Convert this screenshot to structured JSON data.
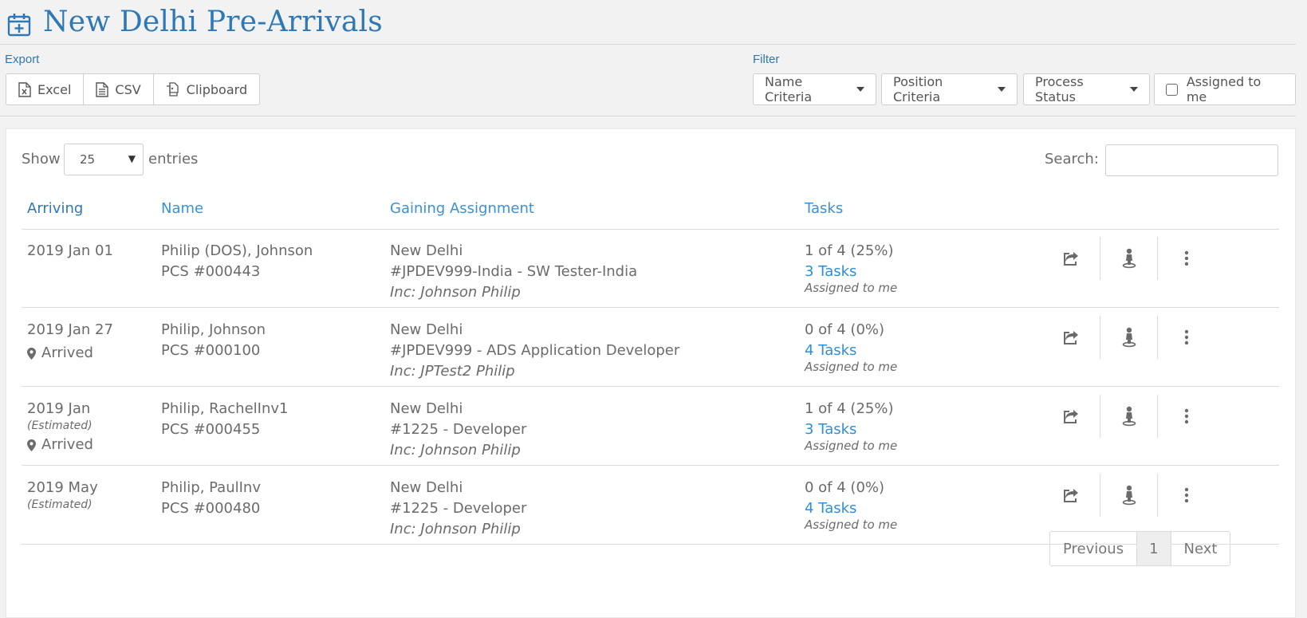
{
  "header": {
    "title": "New Delhi Pre-Arrivals",
    "icon": "calendar-plus-icon"
  },
  "export": {
    "label": "Export",
    "buttons": [
      {
        "label": "Excel",
        "icon": "excel-file-icon"
      },
      {
        "label": "CSV",
        "icon": "csv-file-icon"
      },
      {
        "label": "Clipboard",
        "icon": "clipboard-icon"
      }
    ]
  },
  "filter": {
    "label": "Filter",
    "dropdowns": [
      "Name Criteria",
      "Position Criteria",
      "Process Status"
    ],
    "assigned_label": "Assigned to me"
  },
  "table": {
    "show_label": "Show",
    "length_value": "25",
    "entries_label": "entries",
    "search_label": "Search:",
    "columns": [
      "Arriving",
      "Name",
      "Gaining Assignment",
      "Tasks"
    ],
    "rows": [
      {
        "arriving": "2019 Jan 01",
        "estimated": "",
        "arrived": "",
        "name": "Philip (DOS), Johnson",
        "pcs": "PCS #000443",
        "location": "New Delhi",
        "position": "#JPDEV999-India - SW Tester-India",
        "inc": "Inc: Johnson Philip",
        "progress": "1 of 4 (25%)",
        "tasks_link": "3 Tasks",
        "assigned": "Assigned to me"
      },
      {
        "arriving": "2019 Jan 27",
        "estimated": "",
        "arrived": "Arrived",
        "name": "Philip, Johnson",
        "pcs": "PCS #000100",
        "location": "New Delhi",
        "position": "#JPDEV999 - ADS Application Developer",
        "inc": "Inc: JPTest2 Philip",
        "progress": "0 of 4 (0%)",
        "tasks_link": "4 Tasks",
        "assigned": "Assigned to me"
      },
      {
        "arriving": "2019 Jan",
        "estimated": "(Estimated)",
        "arrived": "Arrived",
        "name": "Philip, RachelInv1",
        "pcs": "PCS #000455",
        "location": "New Delhi",
        "position": "#1225 - Developer",
        "inc": "Inc: Johnson Philip",
        "progress": "1 of 4 (25%)",
        "tasks_link": "3 Tasks",
        "assigned": "Assigned to me"
      },
      {
        "arriving": "2019 May",
        "estimated": "(Estimated)",
        "arrived": "",
        "name": "Philip, PaulInv",
        "pcs": "PCS #000480",
        "location": "New Delhi",
        "position": "#1225 - Developer",
        "inc": "Inc: Johnson Philip",
        "progress": "0 of 4 (0%)",
        "tasks_link": "4 Tasks",
        "assigned": "Assigned to me"
      }
    ],
    "row_actions": [
      "share-icon",
      "person-marker-icon",
      "more-vertical-icon"
    ]
  },
  "pagination": {
    "previous": "Previous",
    "page": "1",
    "next": "Next"
  },
  "colors": {
    "accent": "#2e78b5",
    "link": "#2e8fd6",
    "text": "#6b6b6b",
    "background": "#f2f2f2"
  }
}
